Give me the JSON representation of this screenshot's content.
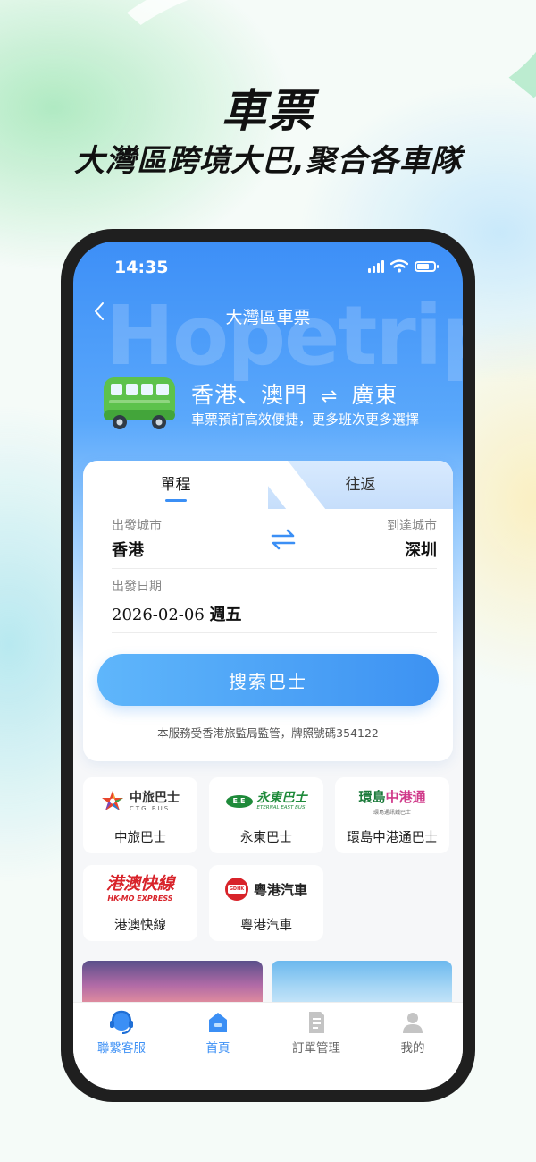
{
  "promo": {
    "title": "車票",
    "subtitle": "大灣區跨境大巴,聚合各車隊"
  },
  "status_bar": {
    "time": "14:35"
  },
  "header": {
    "back_icon": "chevron-left-icon",
    "title": "大灣區車票",
    "watermark": "Hopetrip"
  },
  "hero": {
    "route_from": "香港、澳門",
    "route_arrows": "⇌",
    "route_to": "廣東",
    "tagline": "車票預訂高效便捷，更多班次更多選擇"
  },
  "booking": {
    "tabs": [
      {
        "label": "單程",
        "active": true
      },
      {
        "label": "往返",
        "active": false
      }
    ],
    "departure_label": "出發城市",
    "departure_value": "香港",
    "arrival_label": "到達城市",
    "arrival_value": "深圳",
    "date_label": "出發日期",
    "date_value": "2026-02-06",
    "weekday": "週五",
    "search_button": "搜索巴士",
    "license_note": "本服務受香港旅監局監管，牌照號碼354122"
  },
  "operators": [
    {
      "name": "中旅巴士",
      "logo_text": "中旅巴士",
      "logo_sub": "CTG BUS",
      "icon": "ctg-bus-logo-icon"
    },
    {
      "name": "永東巴士",
      "logo_text": "永東巴士",
      "logo_sub": "ETERNAL EAST BUS",
      "icon": "eternal-east-logo-icon"
    },
    {
      "name": "環島中港通巴士",
      "logo_text": "環島中港通",
      "logo_sub": "環島通訊鐵巴士",
      "icon": "huandao-logo-icon"
    },
    {
      "name": "港澳快線",
      "logo_text": "港澳快線",
      "logo_sub": "HK-MO EXPRESS",
      "icon": "hkmo-express-logo-icon"
    },
    {
      "name": "粵港汽車",
      "logo_text": "粵港汽車",
      "logo_sub": "GDHK",
      "icon": "gdhk-logo-icon"
    }
  ],
  "tabbar": [
    {
      "label": "聯繫客服",
      "icon": "headset-icon",
      "active": false,
      "color": "#3b8ff5"
    },
    {
      "label": "首頁",
      "icon": "home-icon",
      "active": true,
      "color": "#3b8ff5"
    },
    {
      "label": "訂單管理",
      "icon": "document-icon",
      "active": false,
      "color": "#666666"
    },
    {
      "label": "我的",
      "icon": "person-icon",
      "active": false,
      "color": "#666666"
    }
  ],
  "colors": {
    "accent": "#3b8ff5",
    "hero_top": "#3d8ff7",
    "bus_green": "#5dc24c"
  }
}
